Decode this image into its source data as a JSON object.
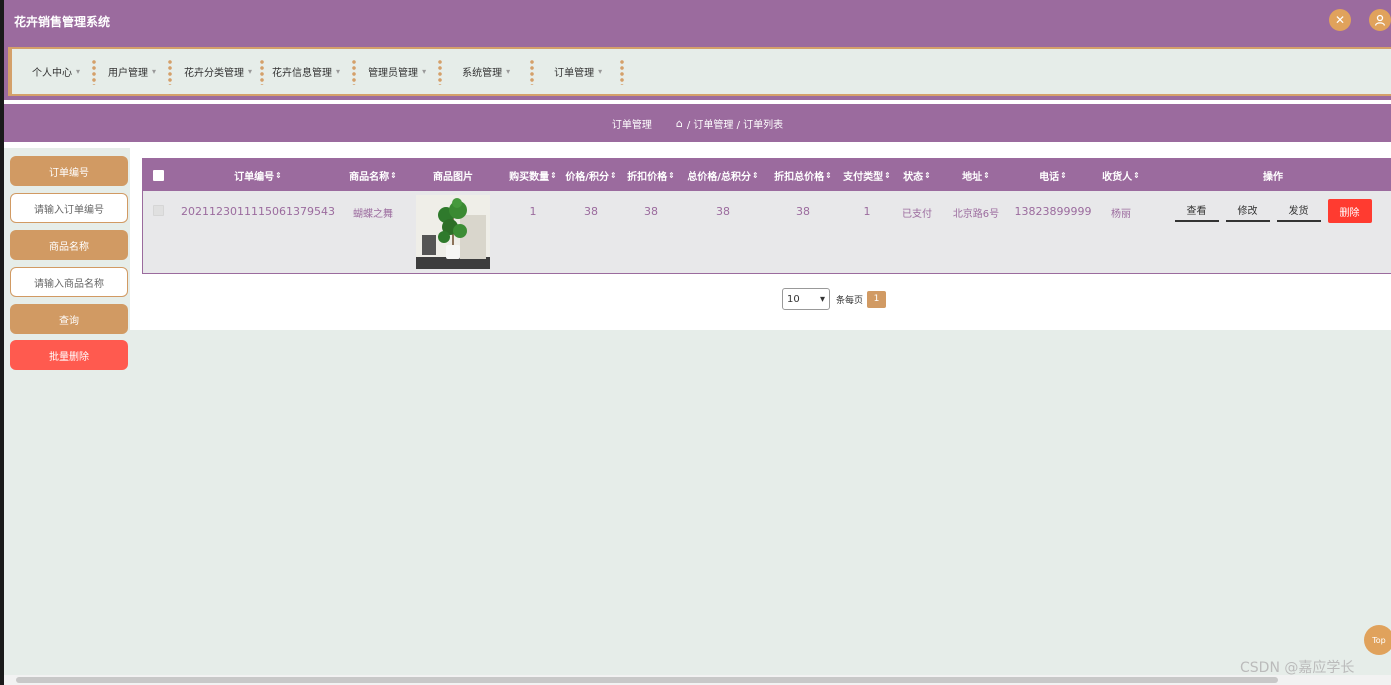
{
  "app": {
    "title": "花卉销售管理系统"
  },
  "nav": [
    {
      "label": "个人中心"
    },
    {
      "label": "用户管理"
    },
    {
      "label": "花卉分类管理"
    },
    {
      "label": "花卉信息管理"
    },
    {
      "label": "管理员管理"
    },
    {
      "label": "系统管理"
    },
    {
      "label": "订单管理"
    }
  ],
  "breadcrumb": {
    "title": "订单管理",
    "path": "/ 订单管理 / 订单列表"
  },
  "search": {
    "order_no_label": "订单编号",
    "order_no_placeholder": "请输入订单编号",
    "product_label": "商品名称",
    "product_placeholder": "请输入商品名称",
    "query_button": "查询",
    "batch_delete_button": "批量删除"
  },
  "table": {
    "headers": [
      "订单编号",
      "商品名称",
      "商品图片",
      "购买数量",
      "价格/积分",
      "折扣价格",
      "总价格/总积分",
      "折扣总价格",
      "支付类型",
      "状态",
      "地址",
      "电话",
      "收货人",
      "操作"
    ],
    "rows": [
      {
        "order_no": "20211230111150613795 43",
        "order_no_display": "2021123011115061379543",
        "product": "蝴蝶之舞",
        "qty": "1",
        "price": "38",
        "discount_price": "38",
        "total": "38",
        "discount_total": "38",
        "pay_type": "1",
        "status": "已支付",
        "address": "北京路6号",
        "phone": "13823899999",
        "receiver": "杨丽",
        "actions": {
          "view": "查看",
          "edit": "修改",
          "ship": "发货",
          "delete": "删除"
        }
      }
    ]
  },
  "pagination": {
    "page_size": "10",
    "per_page_label": "条每页",
    "current_page": "1"
  },
  "top_button": "Top",
  "watermark": "CSDN @嘉应学长",
  "colors": {
    "primary": "#9b6b9e",
    "accent": "#d19a63",
    "danger": "#ff3b30",
    "background": "#e6ede9"
  }
}
